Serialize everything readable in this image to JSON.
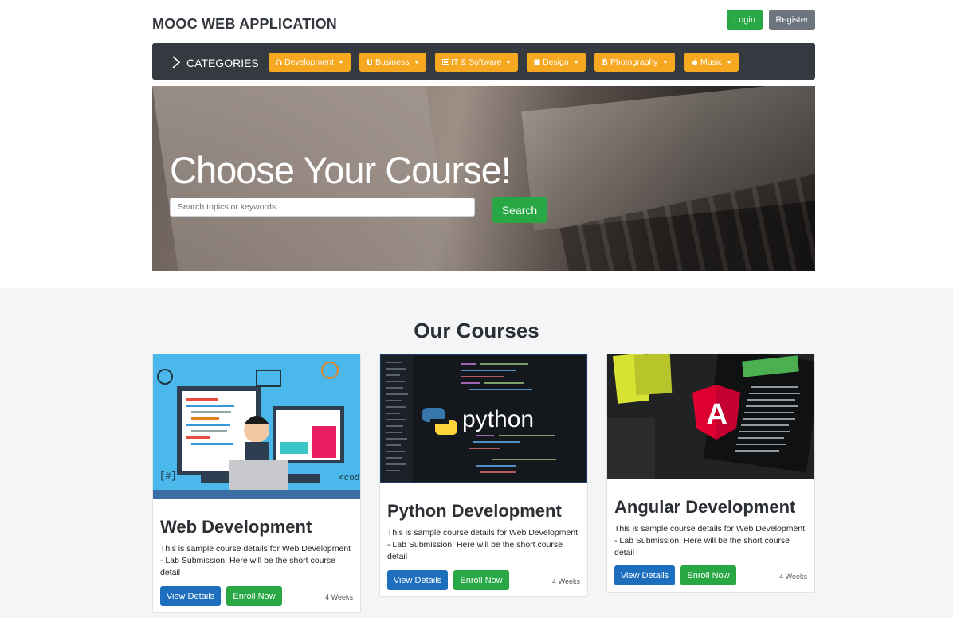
{
  "header": {
    "brand": "MOOC WEB APPLICATION",
    "login_label": "Login",
    "register_label": "Register"
  },
  "categories": {
    "title": "CATEGORIES",
    "items": [
      {
        "label": "Development",
        "icon": "headphones-icon"
      },
      {
        "label": "Business",
        "icon": "magnet-icon"
      },
      {
        "label": "IT & Software",
        "icon": "monitor-icon"
      },
      {
        "label": "Design",
        "icon": "square-icon"
      },
      {
        "label": "Photography",
        "icon": "bitcoin-icon"
      },
      {
        "label": "Music",
        "icon": "apple-icon"
      }
    ]
  },
  "hero": {
    "title": "Choose Your Course!",
    "search_placeholder": "Search topics or keywords",
    "search_label": "Search"
  },
  "courses": {
    "heading": "Our Courses",
    "items": [
      {
        "title": "Web Development",
        "description": "This is sample course details for Web Development - Lab Submission. Here will be the short course detail",
        "view_label": "View Details",
        "enroll_label": "Enroll Now",
        "duration": "4 Weeks",
        "image_text": "<code"
      },
      {
        "title": "Python Development",
        "description": "This is sample course details for Web Development - Lab Submission. Here will be the short course detail",
        "view_label": "View Details",
        "enroll_label": "Enroll Now",
        "duration": "4 Weeks",
        "image_text": "python"
      },
      {
        "title": "Angular Development",
        "description": "This is sample course details for Web Development - Lab Submission. Here will be the short course detail",
        "view_label": "View Details",
        "enroll_label": "Enroll Now",
        "duration": "4 Weeks",
        "image_text": "A"
      }
    ]
  },
  "colors": {
    "success": "#28a745",
    "secondary": "#6c757d",
    "category": "#f6a821",
    "primary": "#1d6fbd",
    "navbar": "#343a40"
  }
}
